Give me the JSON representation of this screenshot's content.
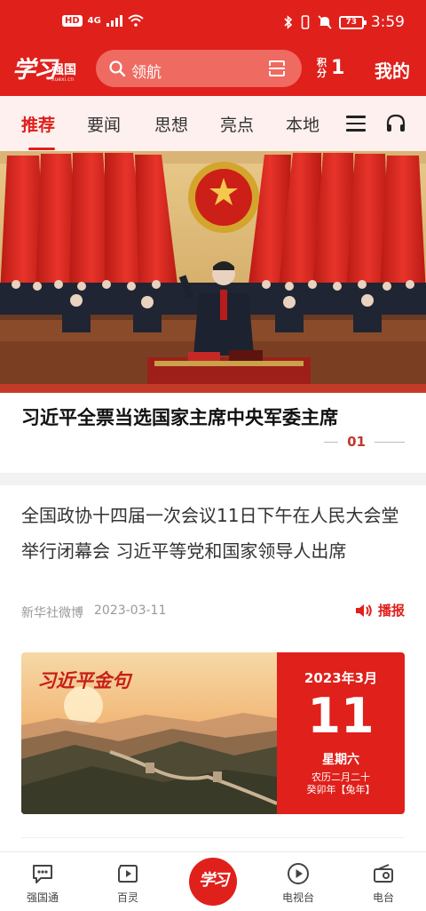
{
  "status_bar": {
    "hd": "HD",
    "net": "4G",
    "battery": "73",
    "time": "3:59"
  },
  "header": {
    "logo_script": "学习",
    "logo_text": "强国",
    "logo_sub": "xuexi.cn",
    "search_placeholder": "领航",
    "points_label": "积分",
    "points_value": "1",
    "mine_label": "我的"
  },
  "tabs": [
    {
      "label": "推荐",
      "active": true
    },
    {
      "label": "要闻",
      "active": false
    },
    {
      "label": "思想",
      "active": false
    },
    {
      "label": "亮点",
      "active": false
    },
    {
      "label": "本地",
      "active": false
    }
  ],
  "hero": {
    "title": "习近平全票当选国家主席中央军委主席",
    "page": "01"
  },
  "article": {
    "title": "全国政协十四届一次会议11日下午在人民大会堂举行闭幕会 习近平等党和国家领导人出席",
    "source": "新华社微博",
    "date": "2023-03-11",
    "broadcast_label": "播报"
  },
  "quote_card": {
    "title": "习近平金句",
    "year_month": "2023年3月",
    "day": "11",
    "weekday": "星期六",
    "lunar": "农历二月二十",
    "ganzhi": "癸卯年【兔年】"
  },
  "bottom_nav": [
    {
      "label": "强国通",
      "icon": "chat-icon"
    },
    {
      "label": "百灵",
      "icon": "video-icon"
    },
    {
      "label": "学习",
      "icon": "xuexi-home-icon"
    },
    {
      "label": "电视台",
      "icon": "play-circle-icon"
    },
    {
      "label": "电台",
      "icon": "radio-icon"
    }
  ],
  "colors": {
    "brand_red": "#e0201b",
    "tab_bg": "#fdf0ee"
  }
}
